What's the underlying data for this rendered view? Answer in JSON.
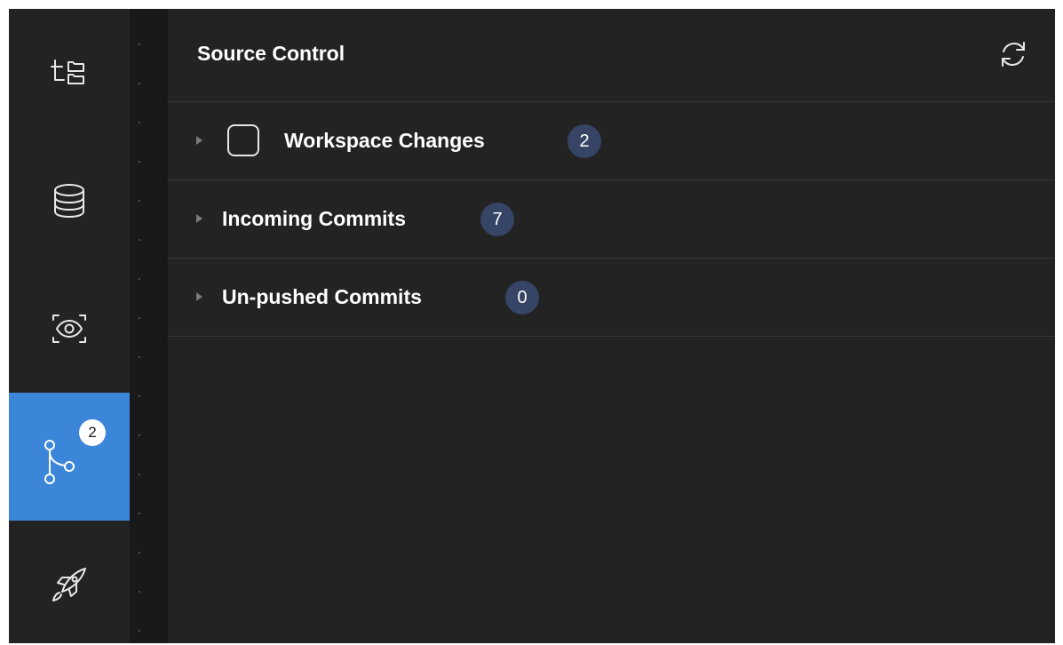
{
  "activity_bar": {
    "items": [
      {
        "icon": "explorer-tree-icon",
        "active": false
      },
      {
        "icon": "database-icon",
        "active": false
      },
      {
        "icon": "eye-scan-icon",
        "active": false
      },
      {
        "icon": "source-control-branch-icon",
        "active": true,
        "badge": "2"
      },
      {
        "icon": "rocket-icon",
        "active": false
      }
    ],
    "accent_color": "#3c86d9"
  },
  "panel": {
    "title": "Source Control",
    "refresh_icon": "refresh-icon",
    "sections": [
      {
        "label": "Workspace Changes",
        "count": "2",
        "has_checkbox": true,
        "checked": false,
        "expanded": false
      },
      {
        "label": "Incoming Commits",
        "count": "7",
        "has_checkbox": false,
        "expanded": false
      },
      {
        "label": "Un-pushed Commits",
        "count": "0",
        "has_checkbox": false,
        "expanded": false
      }
    ]
  },
  "colors": {
    "background": "#232323",
    "badge": "#364466",
    "divider": "#393939"
  }
}
